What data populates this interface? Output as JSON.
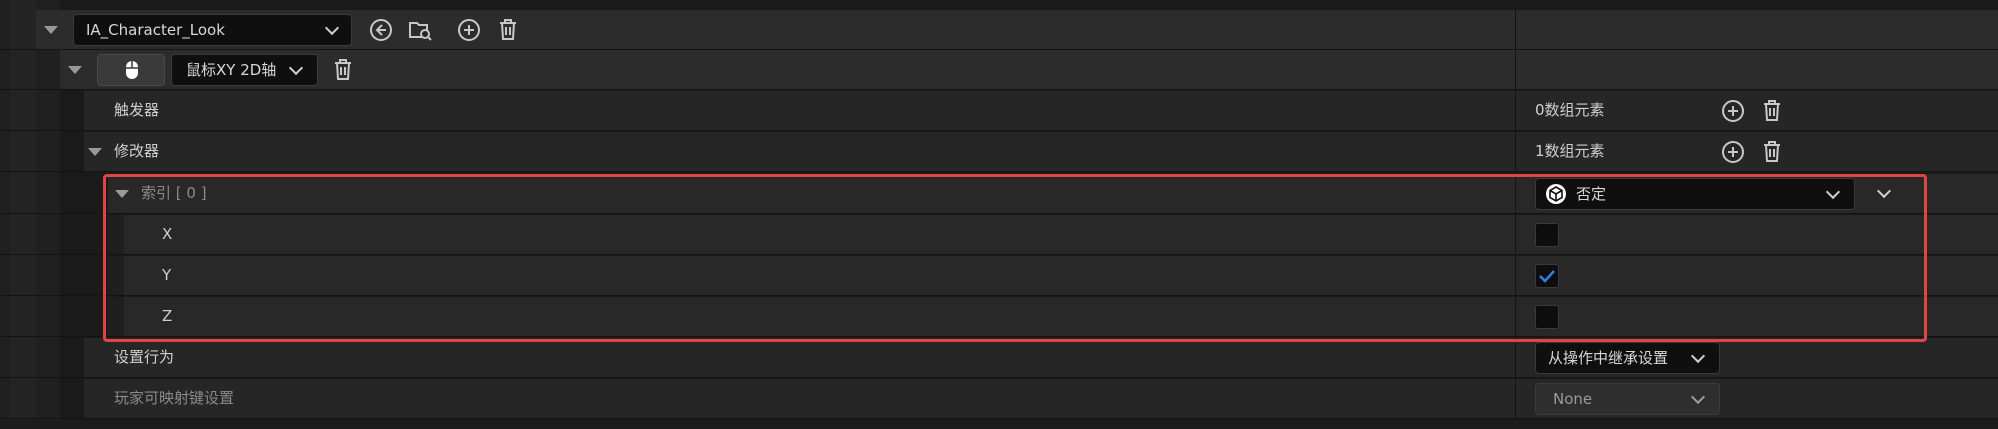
{
  "action": {
    "name": "IA_Character_Look"
  },
  "mapping": {
    "key": "鼠标XY 2D轴"
  },
  "triggers": {
    "label": "触发器",
    "count": "0数组元素"
  },
  "modifiers": {
    "label": "修改器",
    "count": "1数组元素"
  },
  "index0": {
    "label": "索引 [ 0 ]",
    "modifier_value": "否定",
    "axes": [
      {
        "label": "X",
        "checked": false
      },
      {
        "label": "Y",
        "checked": true
      },
      {
        "label": "Z",
        "checked": false
      }
    ]
  },
  "behavior": {
    "label": "设置行为",
    "value": "从操作中继承设置"
  },
  "player_mappable": {
    "label": "玩家可映射键设置",
    "value": "None"
  },
  "colors": {
    "highlight": "#e04545",
    "check": "#2f7fe0"
  }
}
